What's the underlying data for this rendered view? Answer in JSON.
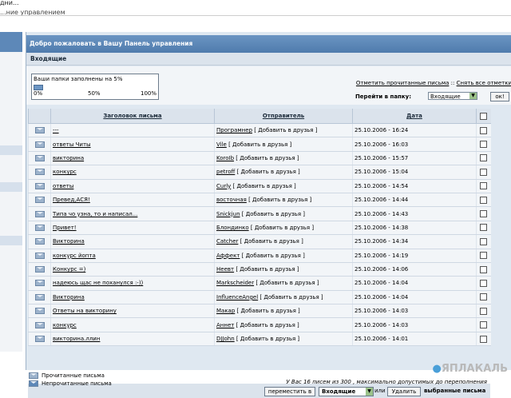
{
  "top": {
    "line1": "дни...",
    "line2": "...ние управлением"
  },
  "panel": {
    "header": "Добро пожаловать в Вашу Панель управления",
    "section": "Входящие"
  },
  "quota": {
    "label": "Ваши папки заполнены на 5%",
    "percent": 5,
    "scale": [
      "0%",
      "50%",
      "100%"
    ]
  },
  "actions": {
    "mark_read": "Отметить прочитанные письма",
    "sep": "::",
    "unmark_all": "Снять все отметки",
    "goto_label": "Перейти в папку:",
    "goto_value": "Входящие",
    "ok": "ок!"
  },
  "columns": {
    "subject": "Заголовок письма",
    "sender": "Отправитель",
    "date": "Дата"
  },
  "add_friend": "[ Добавить в друзья ]",
  "messages": [
    {
      "subject": "---",
      "sender": "Програмнер",
      "date": "25.10.2006 - 16:24"
    },
    {
      "subject": "ответы Читы",
      "sender": "Vile",
      "date": "25.10.2006 - 16:03"
    },
    {
      "subject": "викторина",
      "sender": "KoroIb",
      "date": "25.10.2006 - 15:57"
    },
    {
      "subject": "конкурс",
      "sender": "petroff",
      "date": "25.10.2006 - 15:04"
    },
    {
      "subject": "ответы",
      "sender": "Curly",
      "date": "25.10.2006 - 14:54"
    },
    {
      "subject": "Превед,АСЯ!",
      "sender": "восточная",
      "date": "25.10.2006 - 14:44"
    },
    {
      "subject": "Типа чо узна, то и написал...",
      "sender": "Snickjun",
      "date": "25.10.2006 - 14:43"
    },
    {
      "subject": "Привет!",
      "sender": "Блондинко",
      "date": "25.10.2006 - 14:38"
    },
    {
      "subject": "Викторина",
      "sender": "Catcher",
      "date": "25.10.2006 - 14:34"
    },
    {
      "subject": "конкурс йопта",
      "sender": "Аффект",
      "date": "25.10.2006 - 14:19"
    },
    {
      "subject": "Конкурс =)",
      "sender": "Heeвт",
      "date": "25.10.2006 - 14:06"
    },
    {
      "subject": "надеюсь щас не поханулся :-))",
      "sender": "Markscheider",
      "date": "25.10.2006 - 14:04"
    },
    {
      "subject": "Викторина",
      "sender": "InfluenceAngel",
      "date": "25.10.2006 - 14:04"
    },
    {
      "subject": "Ответы на викторину",
      "sender": "Макар",
      "date": "25.10.2006 - 14:03"
    },
    {
      "subject": "конкурс",
      "sender": "Аннет",
      "date": "25.10.2006 - 14:03"
    },
    {
      "subject": "викторина.ллин",
      "sender": "DJJohn",
      "date": "25.10.2006 - 14:01"
    }
  ],
  "bottom": {
    "move_to": "переместить в",
    "folder": "Входящие",
    "or": "или",
    "delete": "Удалить",
    "selected": "выбранные письма"
  },
  "legend": {
    "read": "Прочитанные письма",
    "unread": "Непрочитанные письма"
  },
  "footer": "У Вас 16 писем из 300 , максимально допустимых до переполнения",
  "logo": "ЯПЛАКАЛЬ",
  "colors": {
    "header": "#5d88b8",
    "panel_bg": "#dfe8f1",
    "row_bg": "#f2f5f8"
  }
}
